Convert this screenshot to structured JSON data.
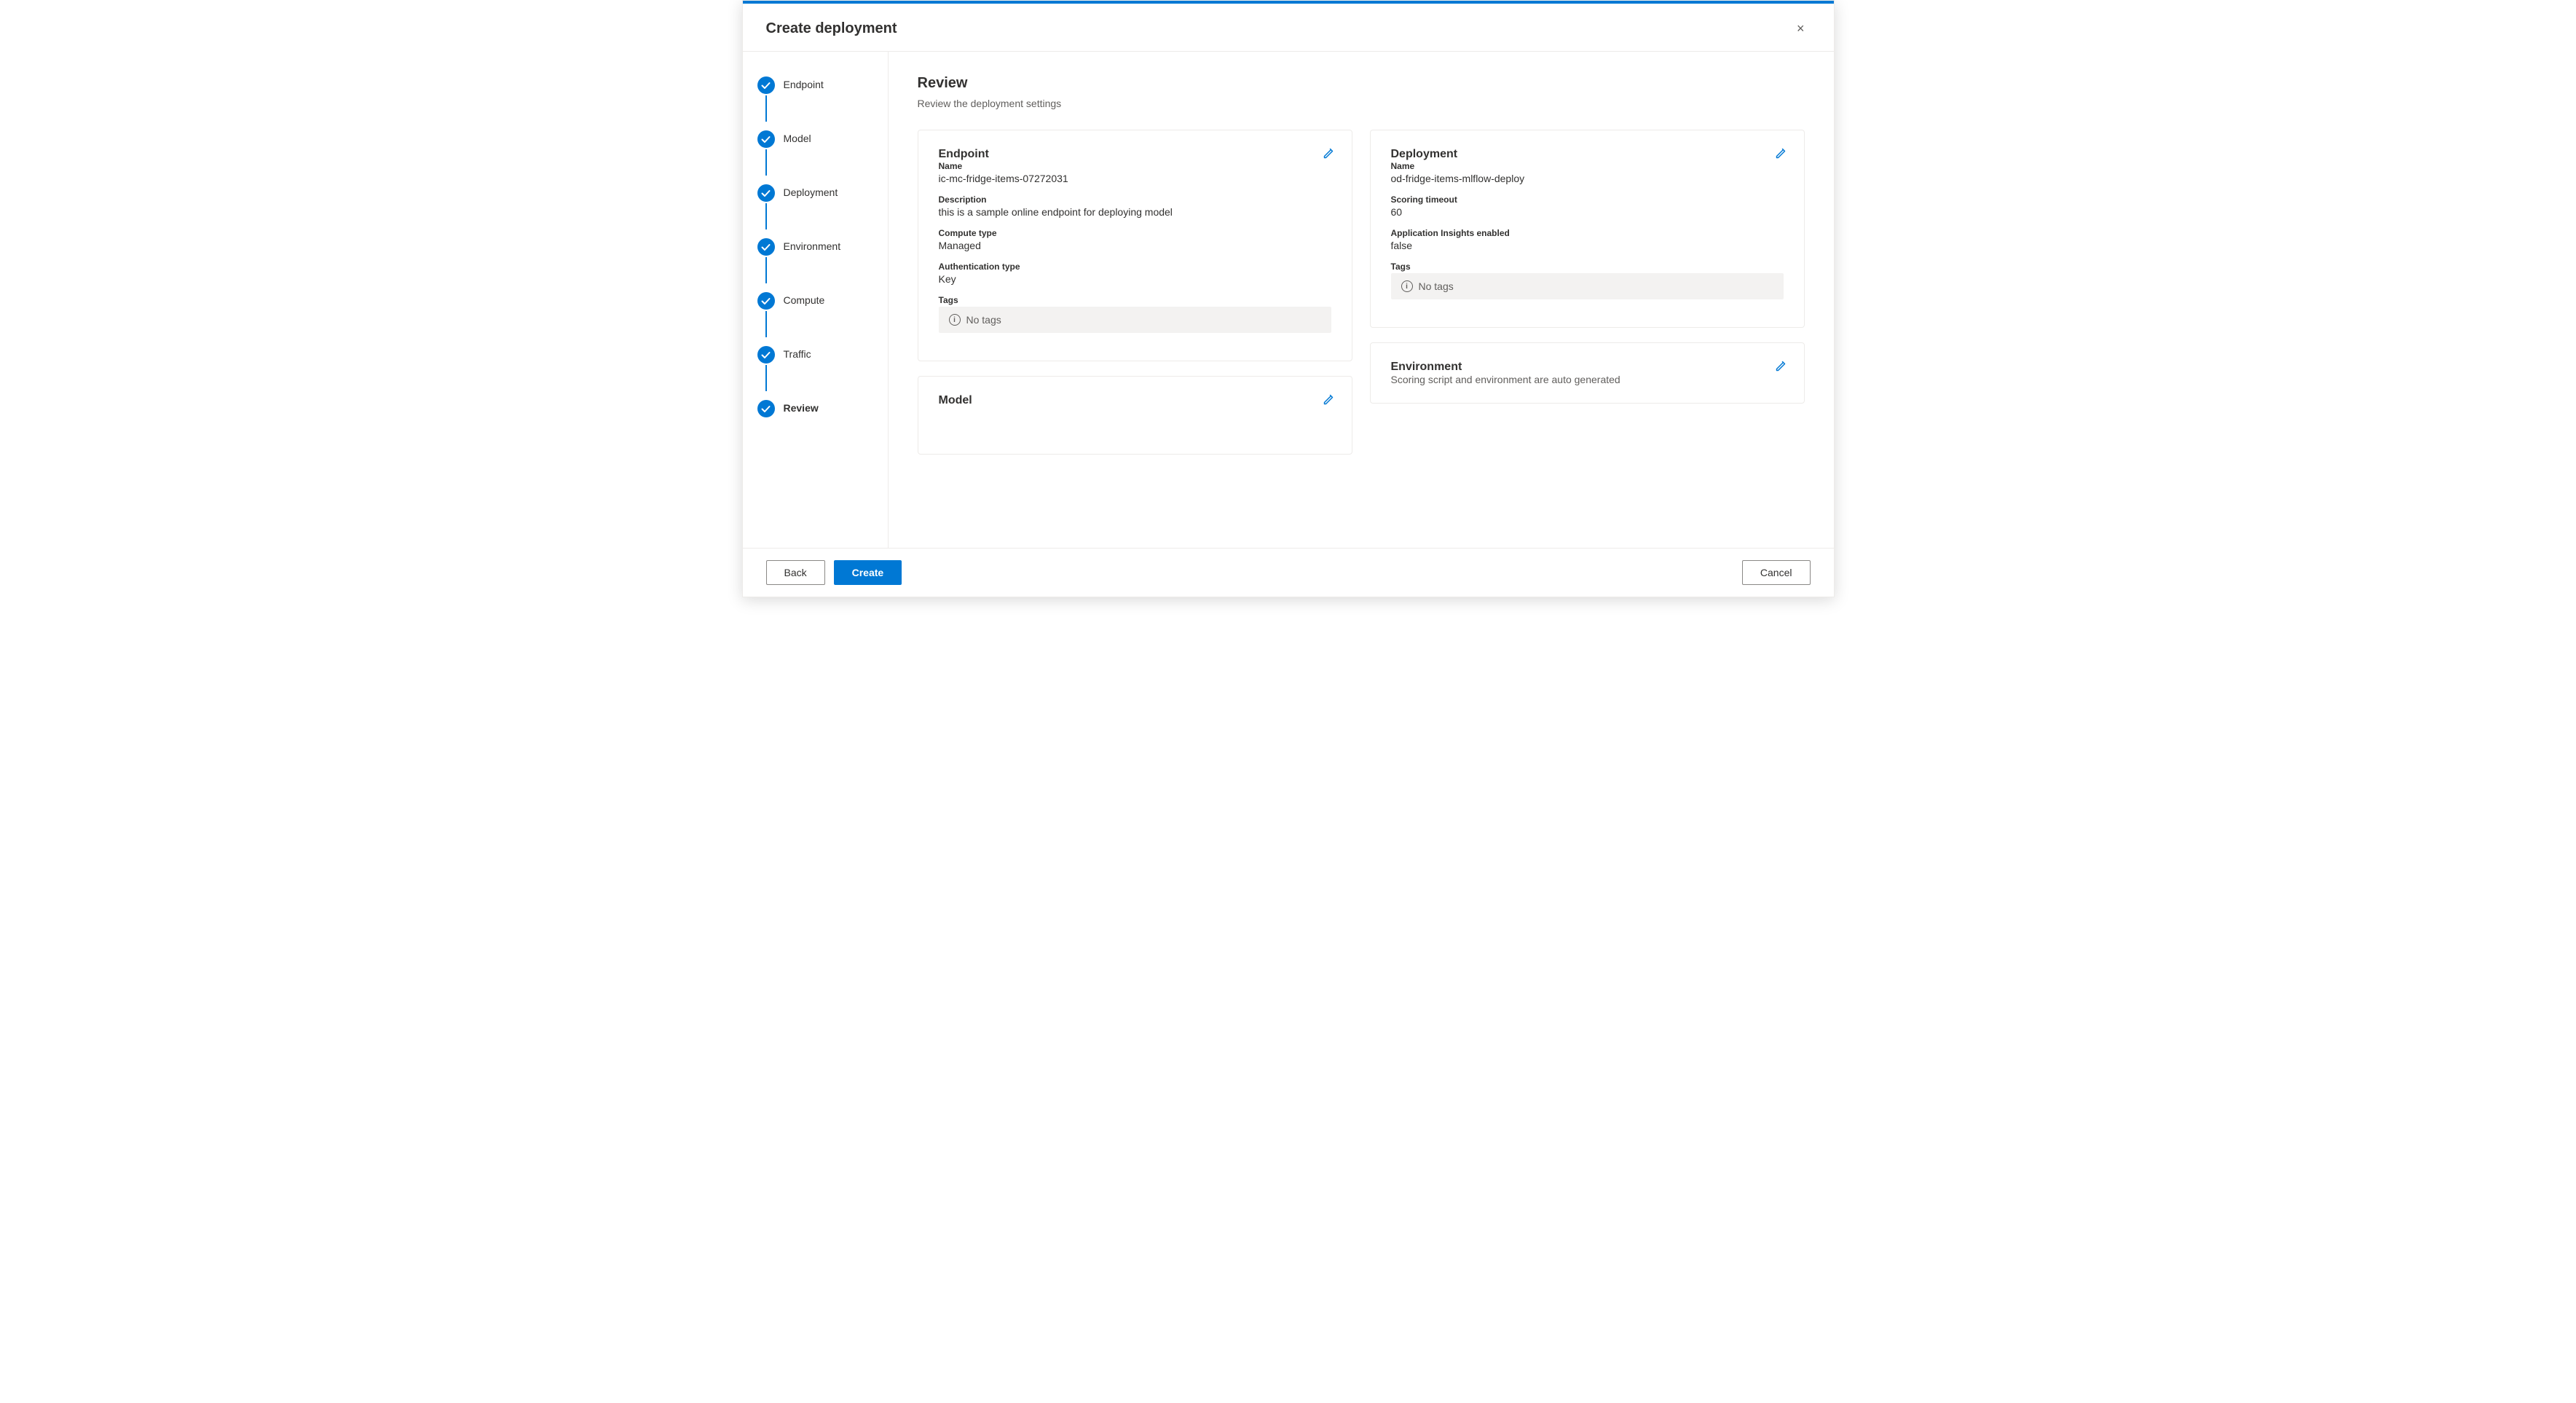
{
  "dialog": {
    "title": "Create deployment",
    "close_label": "×"
  },
  "sidebar": {
    "steps": [
      {
        "id": "endpoint",
        "label": "Endpoint",
        "completed": true,
        "has_connector": true
      },
      {
        "id": "model",
        "label": "Model",
        "completed": true,
        "has_connector": true
      },
      {
        "id": "deployment",
        "label": "Deployment",
        "completed": true,
        "has_connector": true
      },
      {
        "id": "environment",
        "label": "Environment",
        "completed": true,
        "has_connector": true
      },
      {
        "id": "compute",
        "label": "Compute",
        "completed": true,
        "has_connector": true
      },
      {
        "id": "traffic",
        "label": "Traffic",
        "completed": true,
        "has_connector": true
      },
      {
        "id": "review",
        "label": "Review",
        "completed": true,
        "has_connector": false
      }
    ]
  },
  "main": {
    "review": {
      "title": "Review",
      "subtitle": "Review the deployment settings"
    },
    "endpoint_card": {
      "title": "Endpoint",
      "fields": {
        "name_label": "Name",
        "name_value": "ic-mc-fridge-items-07272031",
        "description_label": "Description",
        "description_value": "this is a sample online endpoint for deploying model",
        "compute_type_label": "Compute type",
        "compute_type_value": "Managed",
        "auth_type_label": "Authentication type",
        "auth_type_value": "Key",
        "tags_label": "Tags",
        "tags_no_tags": "No tags"
      }
    },
    "model_card": {
      "title": "Model"
    },
    "deployment_card": {
      "title": "Deployment",
      "fields": {
        "name_label": "Name",
        "name_value": "od-fridge-items-mlflow-deploy",
        "scoring_timeout_label": "Scoring timeout",
        "scoring_timeout_value": "60",
        "app_insights_label": "Application Insights enabled",
        "app_insights_value": "false",
        "tags_label": "Tags",
        "tags_no_tags": "No tags"
      }
    },
    "environment_card": {
      "title": "Environment",
      "description": "Scoring script and environment are auto generated"
    }
  },
  "footer": {
    "back_label": "Back",
    "create_label": "Create",
    "cancel_label": "Cancel"
  },
  "icons": {
    "checkmark": "✓",
    "pencil": "✎",
    "info": "i",
    "close": "✕"
  }
}
